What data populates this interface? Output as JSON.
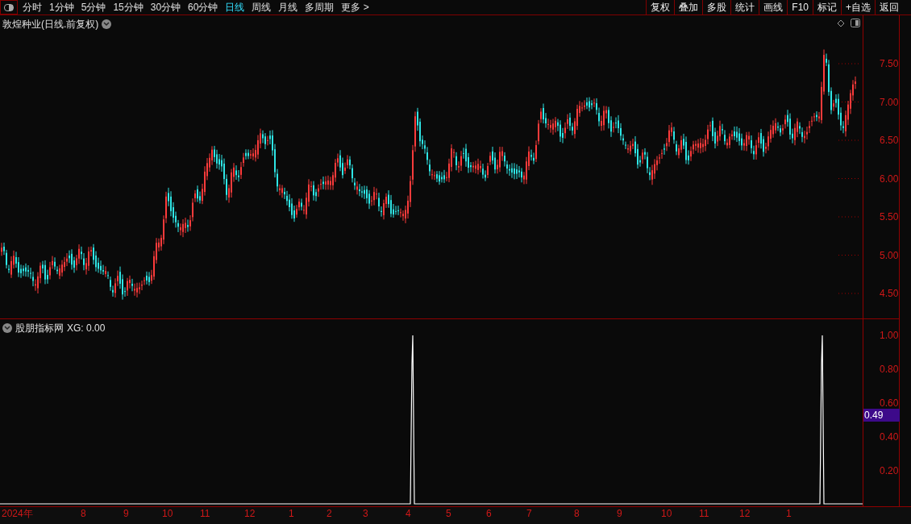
{
  "toolbar": {
    "periods": [
      {
        "label": "分时",
        "selected": false
      },
      {
        "label": "1分钟",
        "selected": false
      },
      {
        "label": "5分钟",
        "selected": false
      },
      {
        "label": "15分钟",
        "selected": false
      },
      {
        "label": "30分钟",
        "selected": false
      },
      {
        "label": "60分钟",
        "selected": false
      },
      {
        "label": "日线",
        "selected": true
      },
      {
        "label": "周线",
        "selected": false
      },
      {
        "label": "月线",
        "selected": false
      },
      {
        "label": "多周期",
        "selected": false
      },
      {
        "label": "更多 >",
        "selected": false
      }
    ],
    "actions": [
      "复权",
      "叠加",
      "多股",
      "统计",
      "画线",
      "F10",
      "标记",
      "+自选",
      "返回"
    ]
  },
  "price_panel": {
    "title": "敦煌种业(日线.前复权)",
    "yticks": [
      "7.50",
      "7.00",
      "6.50",
      "6.00",
      "5.50",
      "5.00",
      "4.50"
    ]
  },
  "indicator_panel": {
    "name": "股朋指标网",
    "reading": "XG: 0.00",
    "yticks": [
      "1.00",
      "0.80",
      "0.60",
      "0.40",
      "0.20"
    ],
    "cursor_value": "0.49"
  },
  "time_axis": [
    "2024年",
    "8",
    "9",
    "10",
    "11",
    "12",
    "1",
    "2",
    "3",
    "4",
    "5",
    "6",
    "7",
    "8",
    "9",
    "10",
    "11",
    "12",
    "1"
  ]
}
